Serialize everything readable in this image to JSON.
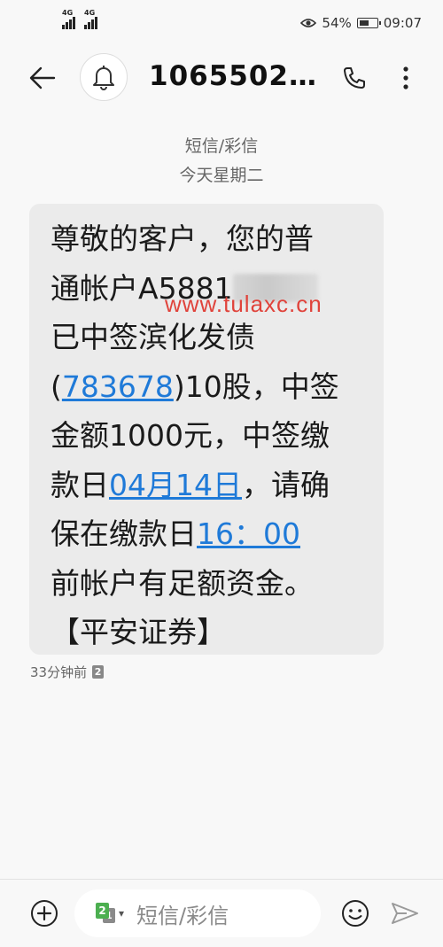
{
  "status_bar": {
    "sim1_network": "4G",
    "sim2_network": "4G",
    "battery": "54%",
    "time": "09:07"
  },
  "header": {
    "contact": "1065502…"
  },
  "conversation": {
    "channel": "短信/彩信",
    "date": "今天星期二"
  },
  "message": {
    "line1": "尊敬的客户，您的普",
    "line2_prefix": "通帐户A5881",
    "line3": "已中签滨化发债",
    "line4_open": "(",
    "line4_code": "783678",
    "line4_rest": ")10股，中签",
    "line5": "金额1000元，中签缴",
    "line6_prefix": "款日",
    "line6_date": "04月14日",
    "line6_rest": "，请确",
    "line7_prefix": "保在缴款日",
    "line7_time": "16：00",
    "line8": "前帐户有足额资金。",
    "line9": "【平安证券】",
    "received": "33分钟前",
    "sim_slot": "2"
  },
  "watermark": "www.tulaxc.cn",
  "composer": {
    "sim_primary": "2",
    "sim_secondary": "1",
    "placeholder": "短信/彩信"
  },
  "icons": {
    "back": "back-arrow-icon",
    "avatar": "bell-icon",
    "call": "phone-icon",
    "more": "more-vertical-icon",
    "add": "plus-circle-icon",
    "emoji": "smiley-icon",
    "send": "send-icon"
  },
  "colors": {
    "link": "#1f7ad8",
    "bubble": "#ebebeb",
    "watermark": "#e0433b"
  }
}
